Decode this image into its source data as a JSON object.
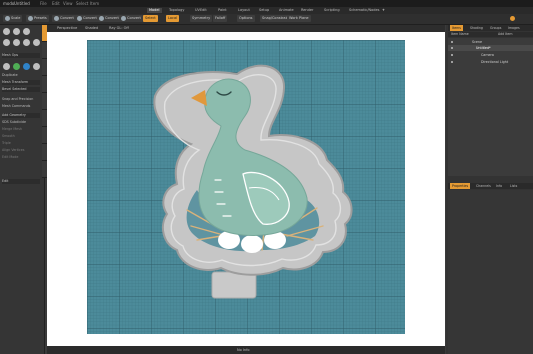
{
  "titlebar": {
    "app": "modo",
    "file": "Untitled",
    "menus": [
      "File",
      "Edit",
      "View",
      "Select",
      "Item",
      "Geometry",
      "Texture",
      "Animate",
      "Render",
      "Layout",
      "System",
      "Help"
    ]
  },
  "layout_tabs": [
    "Model",
    "Topology",
    "UVEdit",
    "Paint",
    "Layout",
    "Setup",
    "Animate",
    "Render",
    "Scripting",
    "Schematic/Nodes"
  ],
  "layout_active": "Model",
  "toolbar": {
    "buttons": [
      "Scale",
      "Presets",
      "Convert",
      "Convert",
      "Convert",
      "Convert",
      "Convert"
    ],
    "orange_buttons": [
      "Select",
      "Local"
    ],
    "extra": [
      "Symmetry",
      "Falloff",
      "Options",
      "Snap/Constraint",
      "Work Plane"
    ]
  },
  "left_panel": {
    "items": [
      {
        "label": "Mesh Ops",
        "dim": false
      },
      {
        "label": "Duplicate",
        "dim": false
      },
      {
        "label": "Mesh Transform",
        "dim": false
      },
      {
        "label": "Bevel Selected",
        "dim": false
      },
      {
        "label": "Snap and Precision",
        "dim": false
      },
      {
        "label": "Mesh Commands",
        "dim": false
      },
      {
        "label": "Add Geometry",
        "dim": false
      },
      {
        "label": "SDS Subdivide",
        "dim": false
      },
      {
        "label": "Merge Mesh",
        "dim": true
      },
      {
        "label": "Smooth",
        "dim": true
      },
      {
        "label": "Triple",
        "dim": true
      },
      {
        "label": "Align Vertices",
        "dim": true
      },
      {
        "label": "Edit Mode",
        "dim": true
      },
      {
        "label": "Edit",
        "dim": false
      }
    ]
  },
  "viewport": {
    "header": [
      "Perspective",
      "Shaded",
      "Ray GL: Off"
    ],
    "footer": "No Info"
  },
  "right_panel": {
    "tabs": [
      "Items",
      "Shading",
      "Groups",
      "Images"
    ],
    "items_header": [
      "Item Name",
      "Add Item"
    ],
    "items": [
      {
        "label": "Scene",
        "indent": 0
      },
      {
        "label": "Untitled*",
        "indent": 1
      },
      {
        "label": "Camera",
        "indent": 2
      },
      {
        "label": "Directional Light",
        "indent": 2
      }
    ],
    "props_tabs": [
      "Properties",
      "Channels",
      "Info",
      "Lists"
    ]
  },
  "colors": {
    "accent": "#e59a33",
    "floor": "#4c8b9a",
    "cutter": "#c4c4c4",
    "goose_body": "#8cbcae",
    "beak": "#e0983c",
    "straw": "#d9b27a"
  }
}
